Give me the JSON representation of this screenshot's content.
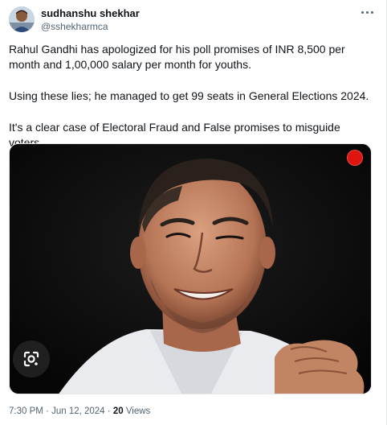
{
  "author": {
    "name": "sudhanshu shekhar",
    "handle": "@sshekharmca"
  },
  "tweet": {
    "paragraph_1": "Rahul Gandhi has apologized for his poll promises of INR 8,500 per month and 1,00,000 salary per month for youths.",
    "paragraph_2": "Using these lies; he managed to get 99 seats in General Elections 2024.",
    "paragraph_3": "It's a clear case of Electoral Fraud and False promises to misguide voters."
  },
  "meta": {
    "time": "7:30 PM",
    "separator": "·",
    "date": "Jun 12, 2024",
    "views_count": "20",
    "views_label": "Views"
  },
  "icons": {
    "more": "more-icon",
    "lens": "google-lens-icon",
    "record": "red-dot-icon"
  },
  "colors": {
    "text": "#0f1419",
    "secondary": "#536471",
    "record_dot": "#e0140f"
  }
}
